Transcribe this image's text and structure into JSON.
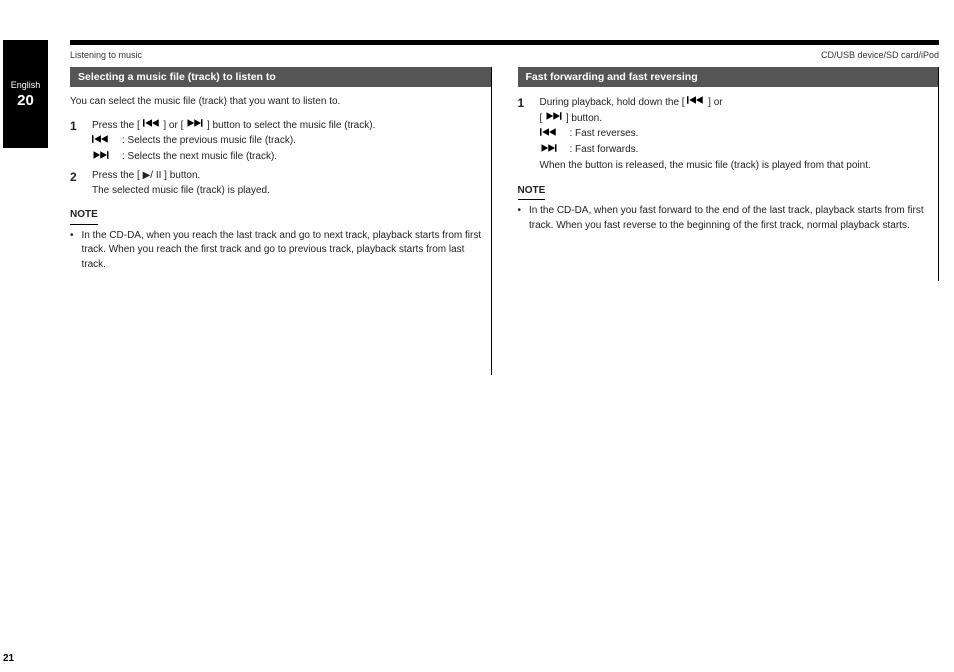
{
  "tab": {
    "top": "English",
    "num": "20"
  },
  "titleRow": {
    "left": "Listening to music",
    "right": "CD/USB device/SD card/iPod"
  },
  "col1": {
    "header": "Selecting a music file (track) to listen to",
    "intro": "You can select the music file (track) that you want to listen to.",
    "step1_label": "1",
    "step1_text_a": "Press the [",
    "step1_text_b": "] or [",
    "step1_text_c": "] button to select the music file (track).",
    "prev_text": ": Selects the previous music file (track).",
    "next_text": ": Selects the next music file (track).",
    "step2_label": "2",
    "step2_text": "Press the [ ▶/ II ] button.",
    "step2_sub": "The selected music file (track) is played.",
    "note_hdr": "NOTE",
    "note_text": "In the CD-DA, when you reach the last track and go to next track, playback starts from first track. When you reach the first track and go to previous track, playback starts from last track."
  },
  "col2": {
    "header": "Fast forwarding and fast reversing",
    "step1_label": "1",
    "step1_text_a": "During playback, hold down the [",
    "step1_text_b": "] or",
    "step1_line2_a": "[",
    "step1_line2_b": "] button.",
    "prev_text": ": Fast reverses.",
    "next_text": ": Fast forwards.",
    "release_text": "When the button is released, the music file (track) is played from that point.",
    "note_hdr": "NOTE",
    "note_text": "In the CD-DA, when you fast forward to the end of the last track, playback starts from first track. When you fast reverse to the beginning of the first track, normal playback starts."
  },
  "pageNum": "21"
}
